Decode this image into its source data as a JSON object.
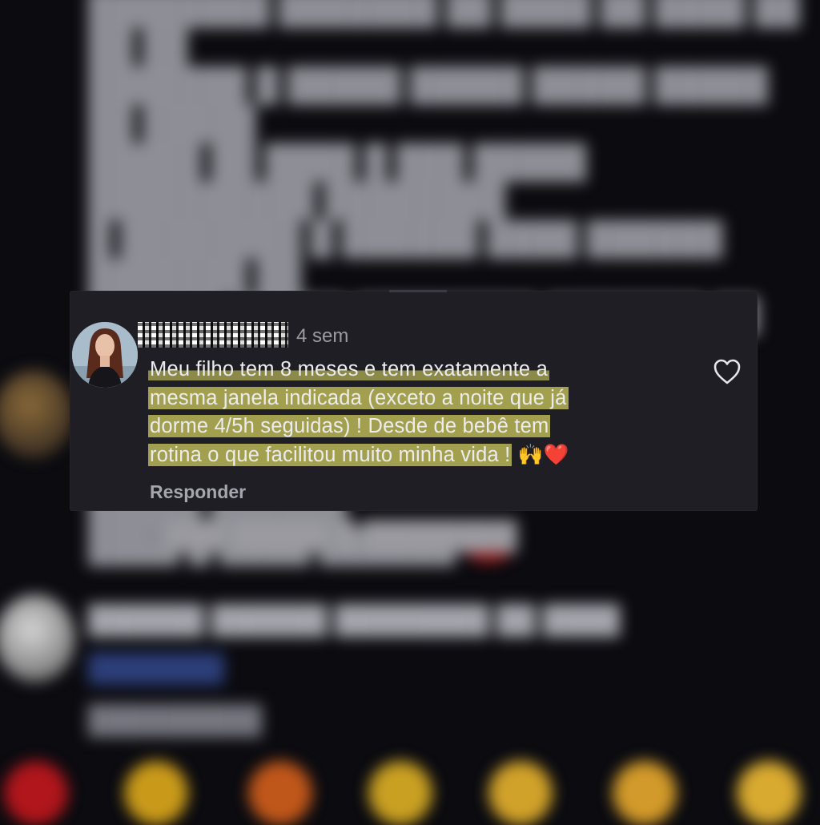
{
  "comment": {
    "time": "4 sem",
    "lines": [
      "Meu filho tem 8 meses e tem exatamente a",
      "mesma janela indicada (exceto a noite que já",
      "dorme 4/5h seguidas) ! Desde de bebê tem",
      "rotina o que facilitou muito minha vida !"
    ],
    "emoji": "🙌❤️",
    "reply_label": "Responder"
  },
  "icons": {
    "like": "heart-outline-icon",
    "avatar": "profile-photo"
  },
  "colors": {
    "background": "#0b0b10",
    "card": "#1e1e24",
    "text": "#ececef",
    "muted": "#9b9ba3",
    "highlight": "#d6d25f"
  }
}
